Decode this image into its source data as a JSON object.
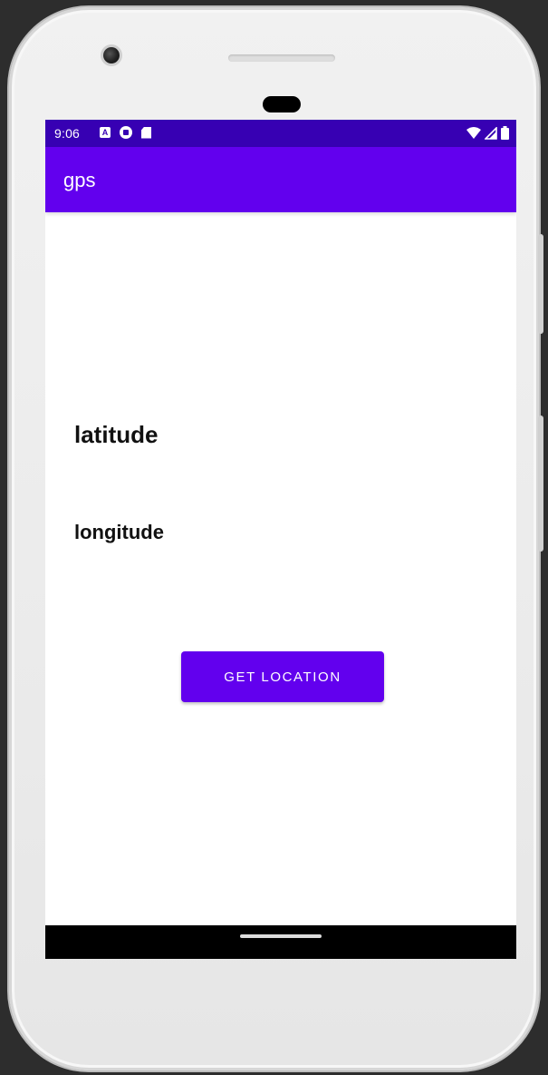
{
  "status_bar": {
    "time": "9:06",
    "left_icons": [
      "a-notification-icon",
      "circle-notification-icon",
      "sd-card-icon"
    ],
    "right_icons": [
      "wifi-icon",
      "signal-icon",
      "battery-icon"
    ],
    "notif_a_glyph": "A"
  },
  "app_bar": {
    "title": "gps"
  },
  "content": {
    "latitude_label": "latitude",
    "longitude_label": "longitude",
    "get_location_button": "GET LOCATION"
  },
  "colors": {
    "primary": "#6200ee",
    "primary_dark": "#3700b3",
    "background": "#ffffff",
    "text": "#111111"
  }
}
